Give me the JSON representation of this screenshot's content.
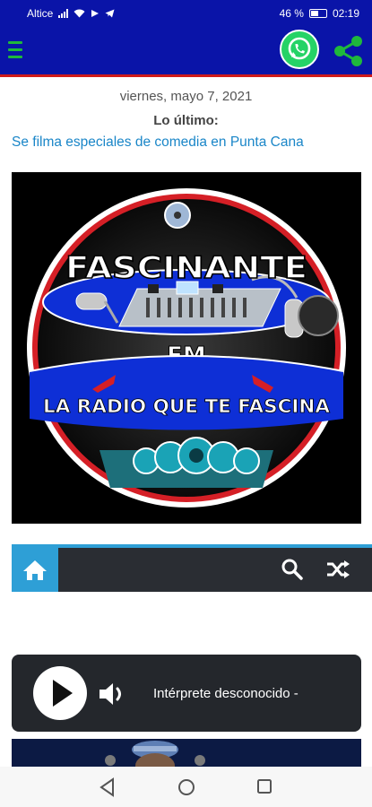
{
  "status_bar": {
    "carrier": "Altice",
    "battery": "46 %",
    "time": "02:19"
  },
  "app_bar": {
    "menu_icon": "hamburger-menu-icon",
    "whatsapp_icon": "whatsapp-icon",
    "share_icon": "share-icon",
    "accent": "#0a14a8",
    "underline": "#d01b1b"
  },
  "content": {
    "date": "viernes, mayo 7, 2021",
    "latest_label": "Lo último:",
    "headline": "Se filma especiales de comedia en Punta Cana"
  },
  "logo": {
    "name": "FASCINANTE",
    "band": "FM",
    "slogan": "LA RADIO QUE TE FASCINA"
  },
  "nav": {
    "home_icon": "home-icon",
    "search_icon": "search-icon",
    "shuffle_icon": "shuffle-icon",
    "accent": "#2e9fd6"
  },
  "player": {
    "play_icon": "play-icon",
    "volume_icon": "volume-icon",
    "track": "Intérprete desconocido -"
  },
  "system_nav": {
    "back_icon": "back-icon",
    "home_icon": "home-circle-icon",
    "recents_icon": "recents-icon"
  }
}
